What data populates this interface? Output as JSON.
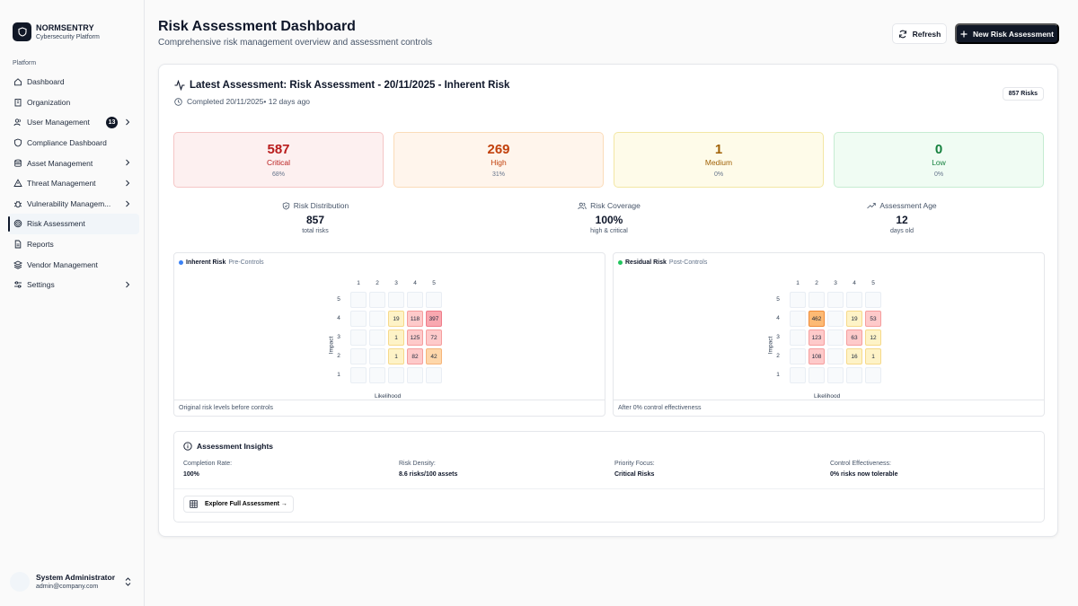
{
  "brand": {
    "name": "NORMSENTRY",
    "subtitle": "Cybersecurity Platform"
  },
  "sidebar": {
    "section_label": "Platform",
    "items": [
      {
        "label": "Dashboard",
        "icon": "home-icon"
      },
      {
        "label": "Organization",
        "icon": "building-icon"
      },
      {
        "label": "User Management",
        "icon": "users-icon",
        "badge": "13",
        "expandable": true
      },
      {
        "label": "Compliance Dashboard",
        "icon": "shield-icon"
      },
      {
        "label": "Asset Management",
        "icon": "database-icon",
        "expandable": true
      },
      {
        "label": "Threat Management",
        "icon": "alert-triangle-icon",
        "expandable": true
      },
      {
        "label": "Vulnerability Managem...",
        "icon": "bug-icon",
        "expandable": true
      },
      {
        "label": "Risk Assessment",
        "icon": "target-icon",
        "active": true
      },
      {
        "label": "Reports",
        "icon": "file-icon"
      },
      {
        "label": "Vendor Management",
        "icon": "layers-icon"
      },
      {
        "label": "Settings",
        "icon": "sliders-icon",
        "expandable": true
      }
    ],
    "user": {
      "name": "System Administrator",
      "email": "admin@company.com"
    }
  },
  "header": {
    "title": "Risk Assessment Dashboard",
    "subtitle": "Comprehensive risk management overview and assessment controls",
    "refresh_label": "Refresh",
    "new_label": "New Risk Assessment"
  },
  "assessment": {
    "title": "Latest Assessment: Risk Assessment - 20/11/2025 - Inherent Risk",
    "completed": "Completed 20/11/2025• 12 days ago",
    "badge": "857 Risks"
  },
  "stats": [
    {
      "value": "587",
      "label": "Critical",
      "pct": "68%"
    },
    {
      "value": "269",
      "label": "High",
      "pct": "31%"
    },
    {
      "value": "1",
      "label": "Medium",
      "pct": "0%"
    },
    {
      "value": "0",
      "label": "Low",
      "pct": "0%"
    }
  ],
  "metrics": [
    {
      "label": "Risk Distribution",
      "value": "857",
      "sub": "total risks"
    },
    {
      "label": "Risk Coverage",
      "value": "100%",
      "sub": "high & critical"
    },
    {
      "label": "Assessment Age",
      "value": "12",
      "sub": "days old"
    }
  ],
  "matrices": {
    "axis_x": "Likelihood",
    "axis_y": "Impact",
    "col_labels": [
      "1",
      "2",
      "3",
      "4",
      "5"
    ],
    "row_labels": [
      "5",
      "4",
      "3",
      "2",
      "1"
    ],
    "inherent": {
      "title": "Inherent Risk",
      "subtitle": "Pre-Controls",
      "footer": "Original risk levels before controls",
      "dot_color": "#3b82f6",
      "cells": [
        [
          "",
          "",
          "",
          "",
          ""
        ],
        [
          "",
          "",
          "19",
          "118",
          "397"
        ],
        [
          "",
          "",
          "1",
          "125",
          "72"
        ],
        [
          "",
          "",
          "1",
          "82",
          "42"
        ],
        [
          "",
          "",
          "",
          "",
          ""
        ]
      ]
    },
    "residual": {
      "title": "Residual Risk",
      "subtitle": "Post-Controls",
      "footer": "After 0% control effectiveness",
      "dot_color": "#22c55e",
      "cells": [
        [
          "",
          "",
          "",
          "",
          ""
        ],
        [
          "",
          "462",
          "",
          "19",
          "53"
        ],
        [
          "",
          "123",
          "",
          "63",
          "12"
        ],
        [
          "",
          "108",
          "",
          "16",
          "1"
        ],
        [
          "",
          "",
          "",
          "",
          ""
        ]
      ]
    }
  },
  "insights": {
    "title": "Assessment Insights",
    "items": [
      {
        "label": "Completion Rate:",
        "value": "100%"
      },
      {
        "label": "Risk Density:",
        "value": "8.6 risks/100 assets"
      },
      {
        "label": "Priority Focus:",
        "value": "Critical Risks"
      },
      {
        "label": "Control Effectiveness:",
        "value": "0% risks now tolerable"
      }
    ],
    "explore_label": "Explore Full Assessment →"
  }
}
